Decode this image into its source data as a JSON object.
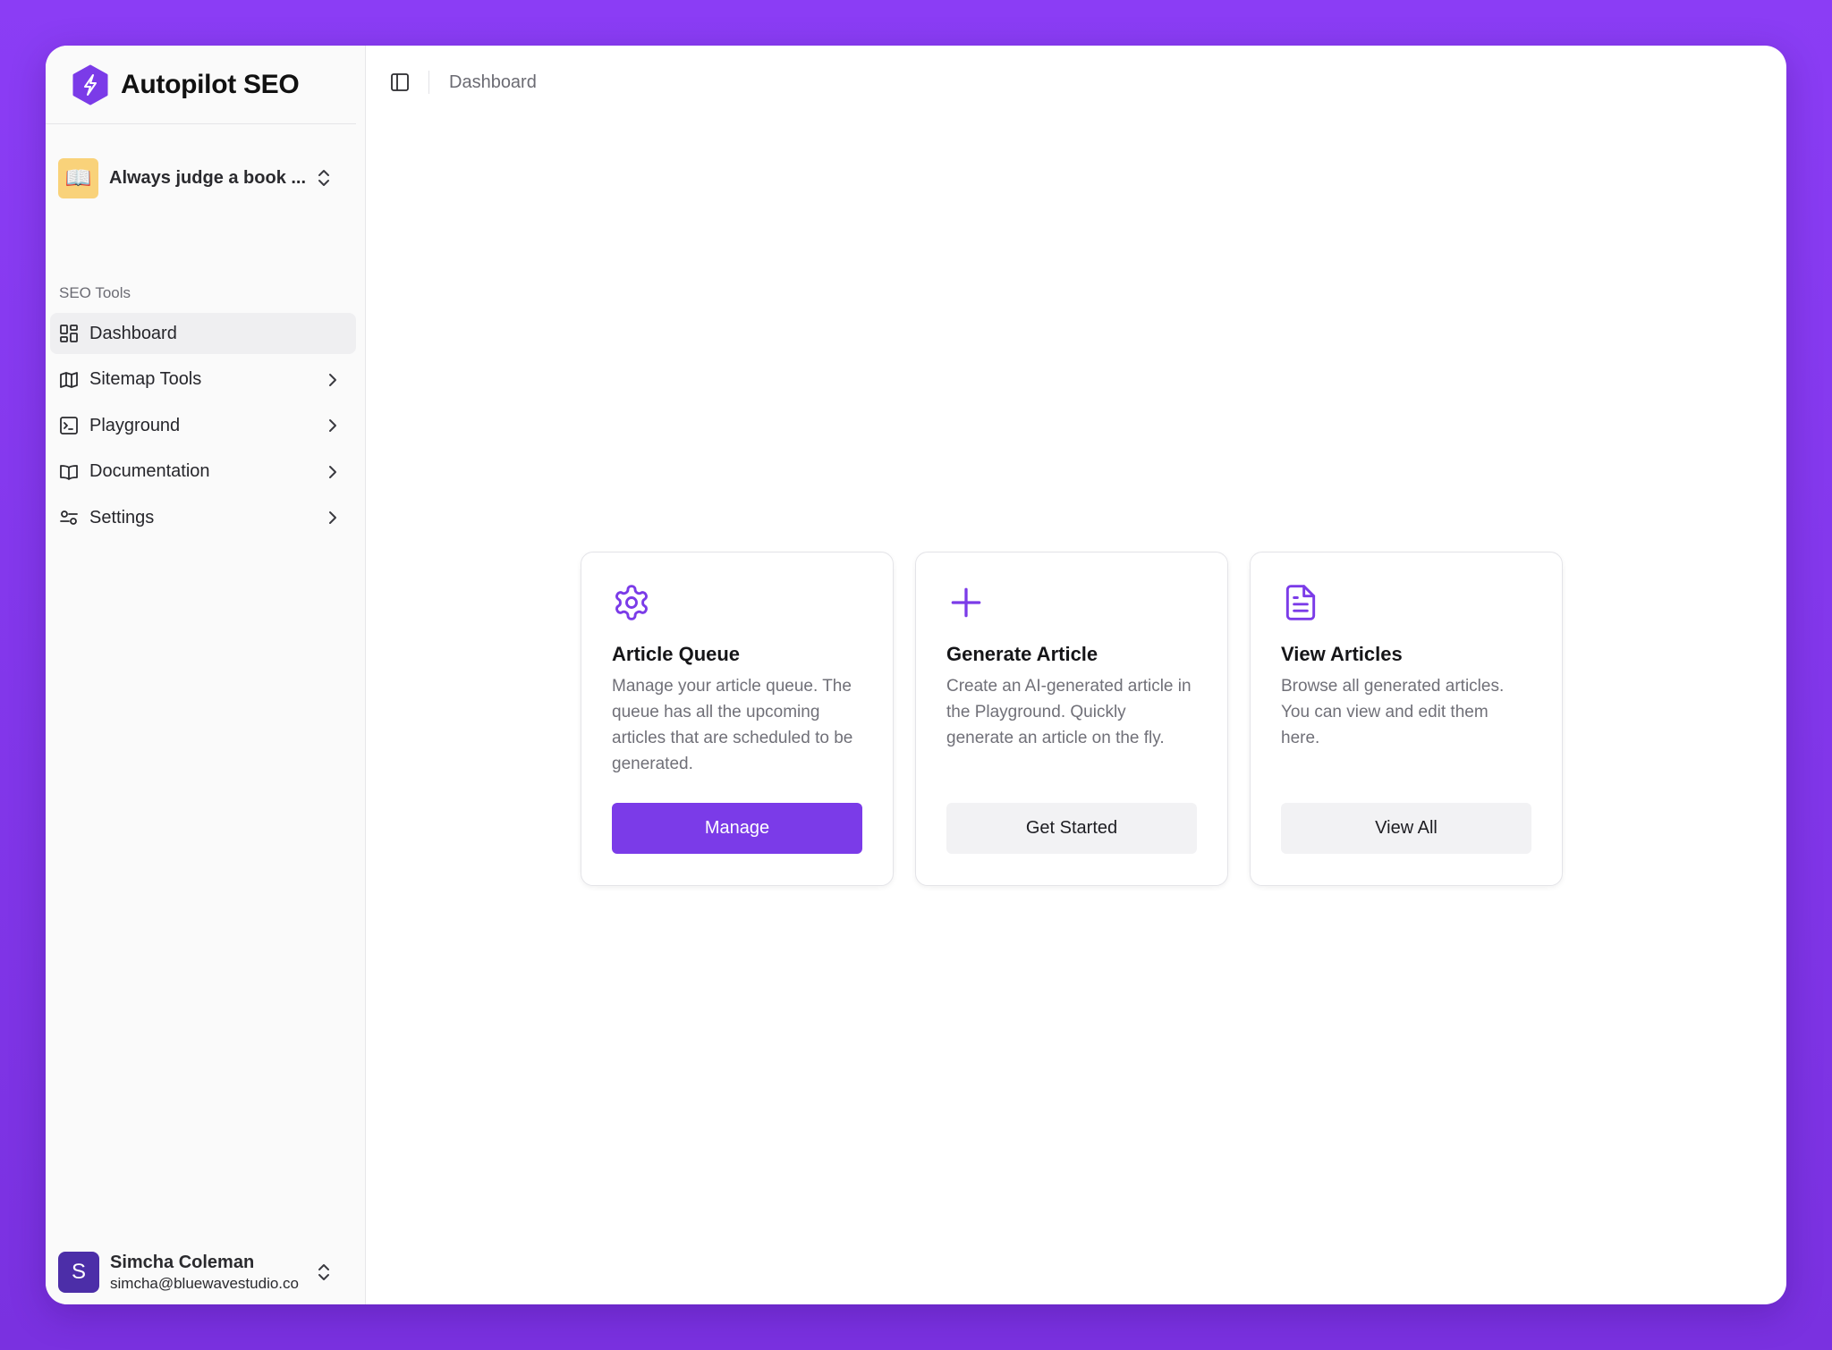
{
  "brand": {
    "name": "Autopilot SEO",
    "logo_icon": "lightning-hexagon-icon",
    "accent": "#7b3be8"
  },
  "workspace": {
    "emoji": "📖",
    "name": "Always judge a book ..."
  },
  "sidebar": {
    "group_label": "SEO Tools",
    "items": [
      {
        "label": "Dashboard",
        "icon": "layout-dashboard-icon",
        "active": true
      },
      {
        "label": "Sitemap Tools",
        "icon": "map-icon"
      },
      {
        "label": "Playground",
        "icon": "terminal-square-icon"
      },
      {
        "label": "Documentation",
        "icon": "book-open-icon"
      },
      {
        "label": "Settings",
        "icon": "sliders-icon"
      }
    ]
  },
  "user": {
    "initial": "S",
    "name": "Simcha Coleman",
    "email": "simcha@bluewavestudio.co"
  },
  "topbar": {
    "breadcrumb": "Dashboard"
  },
  "cards": [
    {
      "icon": "gear-icon",
      "title": "Article Queue",
      "description": "Manage your article queue. The queue has all the upcoming articles that are scheduled to be generated.",
      "button": "Manage",
      "variant": "primary"
    },
    {
      "icon": "plus-icon",
      "title": "Generate Article",
      "description": "Create an AI-generated article in the Playground. Quickly generate an article on the fly.",
      "button": "Get Started",
      "variant": "secondary"
    },
    {
      "icon": "file-text-icon",
      "title": "View Articles",
      "description": "Browse all generated articles. You can view and edit them here.",
      "button": "View All",
      "variant": "secondary"
    }
  ]
}
